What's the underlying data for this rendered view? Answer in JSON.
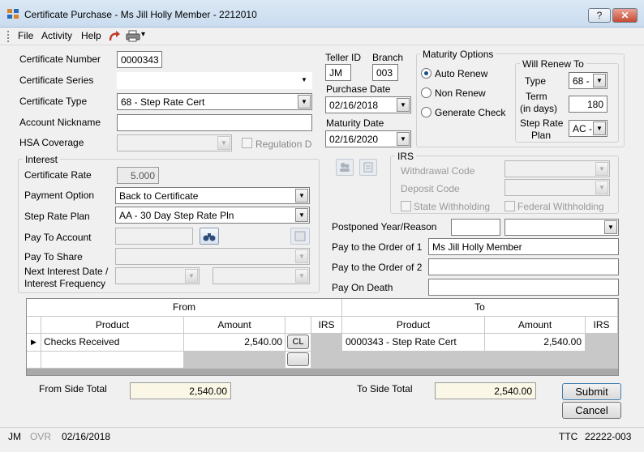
{
  "window": {
    "title": "Certificate Purchase - Ms Jill Holly Member - 2212010",
    "help_btn": "?",
    "close_btn": "✕"
  },
  "menu": {
    "file": "File",
    "activity": "Activity",
    "help": "Help",
    "dropdown_arrow": "▾"
  },
  "certificate": {
    "number_label": "Certificate Number",
    "number": "0000343",
    "series_label": "Certificate Series",
    "series": "",
    "type_label": "Certificate Type",
    "type": "68 - Step Rate Cert",
    "nickname_label": "Account Nickname",
    "nickname": "",
    "hsa_label": "HSA Coverage",
    "hsa": "",
    "regulation_d_label": "Regulation D"
  },
  "interest": {
    "title": "Interest",
    "rate_label": "Certificate Rate",
    "rate": "5.000",
    "payment_option_label": "Payment Option",
    "payment_option": "Back to Certificate",
    "step_rate_plan_label": "Step Rate Plan",
    "step_rate_plan": "AA - 30 Day Step Rate Pln",
    "pay_to_account_label": "Pay To Account",
    "pay_to_account": "",
    "pay_to_share_label": "Pay To Share",
    "pay_to_share": "",
    "next_interest_label_1": "Next Interest Date /",
    "next_interest_label_2": "Interest Frequency"
  },
  "teller": {
    "teller_id_label": "Teller ID",
    "teller_id": "JM",
    "branch_label": "Branch",
    "branch": "003",
    "purchase_date_label": "Purchase Date",
    "purchase_date": "02/16/2018",
    "maturity_date_label": "Maturity Date",
    "maturity_date": "02/16/2020"
  },
  "maturity": {
    "title": "Maturity Options",
    "auto_renew": "Auto Renew",
    "non_renew": "Non Renew",
    "generate_check": "Generate Check",
    "selected": "Auto Renew",
    "will_renew_title": "Will Renew To",
    "type_label": "Type",
    "type_value": "68 -",
    "term_label_1": "Term",
    "term_label_2": "(in days)",
    "term_value": "180",
    "step_rate_label_1": "Step Rate",
    "step_rate_label_2": "Plan",
    "step_rate_value": "AC -"
  },
  "irs": {
    "title": "IRS",
    "withdrawal_code_label": "Withdrawal Code",
    "deposit_code_label": "Deposit Code",
    "state_withholding_label": "State Withholding",
    "federal_withholding_label": "Federal Withholding"
  },
  "payto": {
    "postponed_label": "Postponed Year/Reason",
    "postponed_year": "",
    "postponed_reason": "",
    "order1_label": "Pay to the Order of 1",
    "order1": "Ms Jill Holly Member",
    "order2_label": "Pay to the Order of 2",
    "order2": "",
    "pod_label": "Pay On Death",
    "pod": ""
  },
  "grid": {
    "from_header": "From",
    "to_header": "To",
    "columns": {
      "product": "Product",
      "amount": "Amount",
      "irs": "IRS"
    },
    "rows": [
      {
        "from_product": "Checks Received",
        "from_amount": "2,540.00",
        "from_btn": "CL",
        "from_irs": "",
        "to_product": "0000343 - Step Rate Cert",
        "to_amount": "2,540.00",
        "to_irs": ""
      }
    ],
    "row_marker": "▶"
  },
  "totals": {
    "from_label": "From Side Total",
    "from_value": "2,540.00",
    "to_label": "To Side Total",
    "to_value": "2,540.00"
  },
  "buttons": {
    "submit": "Submit",
    "cancel": "Cancel"
  },
  "status": {
    "user": "JM",
    "ovr": "OVR",
    "date": "02/16/2018",
    "ttc_label": "TTC",
    "ttc_value": "22222-003"
  },
  "colors": {
    "accent": "#1a4f8f",
    "redo_arrow": "#c0392b"
  }
}
